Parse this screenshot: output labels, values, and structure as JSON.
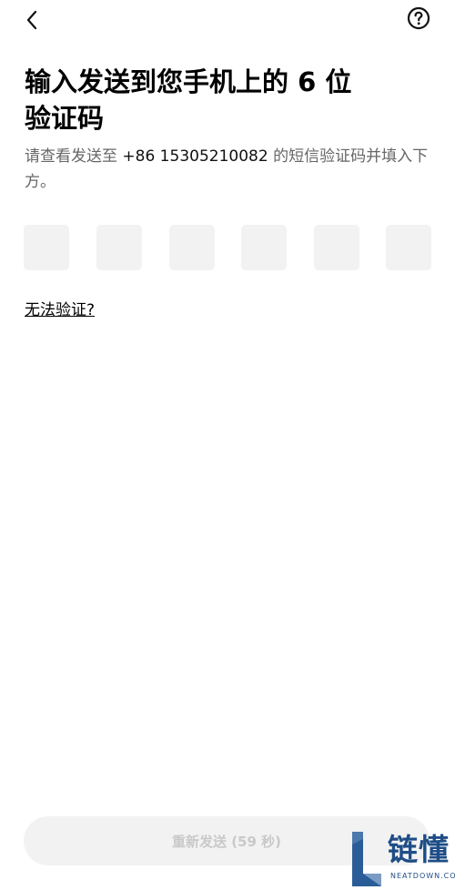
{
  "header": {
    "back_icon": "chevron-left-icon",
    "help_icon": "question-circle-icon"
  },
  "title_line1": "输入发送到您手机上的 6 位",
  "title_line2": "验证码",
  "subtitle": {
    "prefix": "请查看发送至 ",
    "phone": "+86 15305210082",
    "suffix": " 的短信验证码并填入下方。"
  },
  "code": {
    "length": 6,
    "digits": [
      "",
      "",
      "",
      "",
      "",
      ""
    ]
  },
  "cant_verify_label": "无法验证?",
  "resend_label": "重新发送 (59 秒)",
  "watermark": {
    "name": "链懂",
    "sub": "NEATDOWN.COM"
  },
  "colors": {
    "text": "#000000",
    "muted": "#666666",
    "box_bg": "#f2f2f2",
    "disabled_text": "#c9c9c9",
    "watermark": "#1e4d86"
  }
}
